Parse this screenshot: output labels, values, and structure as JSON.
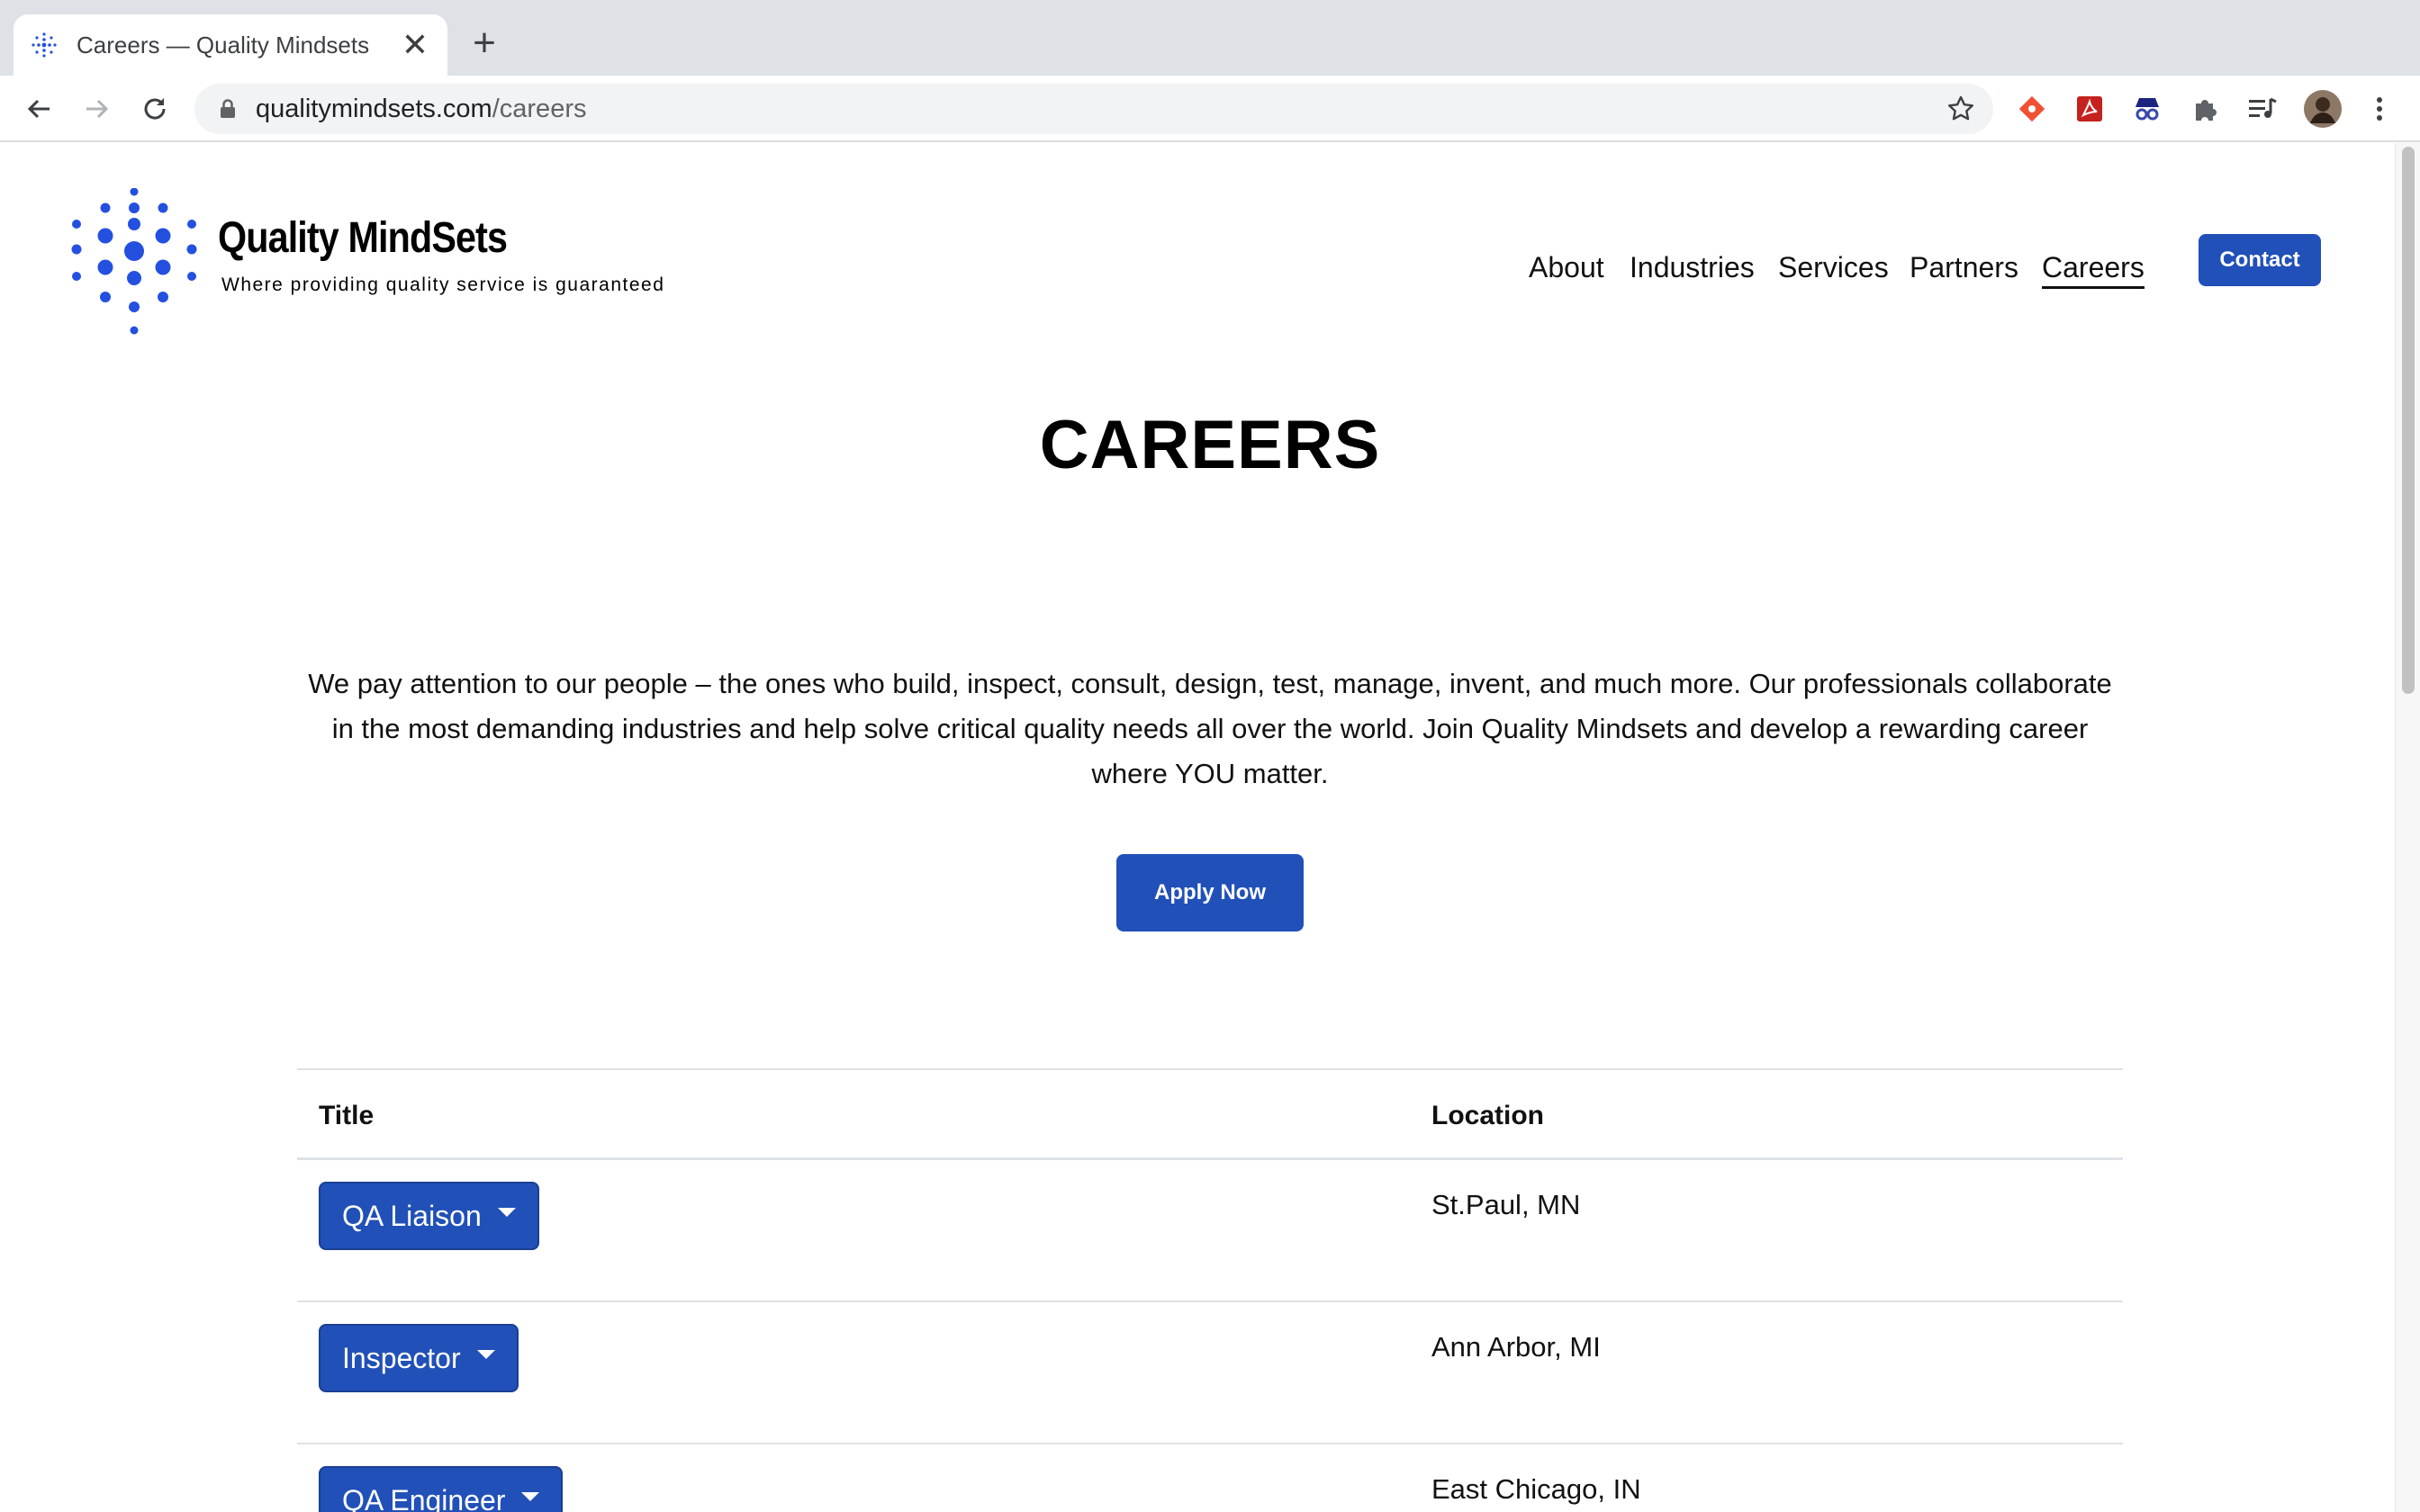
{
  "browser": {
    "tab_title": "Careers — Quality Mindsets",
    "tab_close": "✕",
    "new_tab": "+",
    "url_host": "qualitymindsets.com",
    "url_path": "/careers",
    "icons": [
      "back-arrow-icon",
      "forward-arrow-icon",
      "reload-icon",
      "lock-icon",
      "bookmark-star-icon",
      "extension-icons",
      "profile-avatar",
      "kebab-menu-icon"
    ]
  },
  "site": {
    "brand_name": "Quality MindSets",
    "tagline": "Where providing quality service is guaranteed",
    "accent_color": "#2150b8",
    "logo_color": "#2450e0"
  },
  "nav": {
    "items": [
      {
        "label": "About"
      },
      {
        "label": "Industries"
      },
      {
        "label": "Services"
      },
      {
        "label": "Partners"
      },
      {
        "label": "Careers",
        "active": true
      }
    ],
    "contact_label": "Contact"
  },
  "main": {
    "heading": "CAREERS",
    "intro": "We pay attention to our people – the ones who build, inspect, consult, design, test, manage, invent, and much more. Our professionals collaborate in the most demanding industries and help solve critical quality needs all over the world. Join Quality Mindsets and develop a rewarding career where YOU matter.",
    "apply_label": "Apply Now"
  },
  "jobs": {
    "columns": {
      "title": "Title",
      "location": "Location"
    },
    "rows": [
      {
        "title": "QA Liaison",
        "location": "St.Paul, MN"
      },
      {
        "title": "Inspector",
        "location": "Ann Arbor, MI"
      },
      {
        "title": "QA Engineer",
        "location": "East Chicago, IN"
      }
    ]
  }
}
